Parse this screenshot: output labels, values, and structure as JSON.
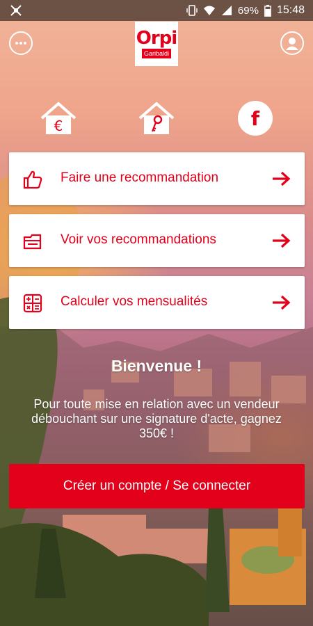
{
  "status_bar": {
    "battery": "69%",
    "time": "15:48"
  },
  "logo": {
    "word": "Orpi",
    "subtitle": "Garibaldi"
  },
  "quick_actions": {
    "euro_symbol": "€",
    "facebook_letter": "f"
  },
  "menu": [
    {
      "label": "Faire une recommandation",
      "icon": "thumbs-up-icon"
    },
    {
      "label": "Voir vos recommandations",
      "icon": "folder-icon"
    },
    {
      "label": "Calculer vos mensualités",
      "icon": "calculator-icon"
    }
  ],
  "welcome": {
    "title": "Bienvenue !",
    "text": "Pour toute mise en relation avec un vendeur débouchant sur une signature d'acte, gagnez 350€ !"
  },
  "cta": {
    "label": "Créer un compte / Se connecter"
  },
  "colors": {
    "brand_red": "#e2001a"
  }
}
